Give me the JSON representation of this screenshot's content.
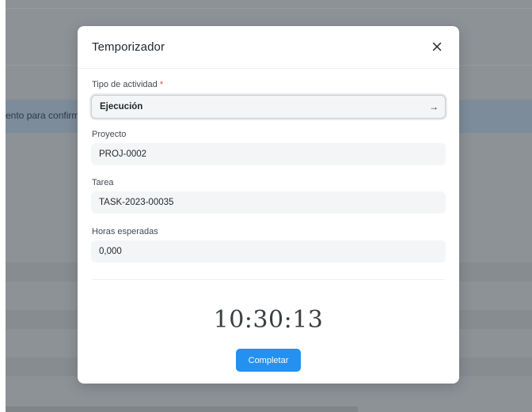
{
  "background": {
    "partial_text": "ento para confirm"
  },
  "modal": {
    "title": "Temporizador",
    "close_icon": "close-icon",
    "fields": {
      "activity_type": {
        "label": "Tipo de actividad",
        "required_mark": "*",
        "value": "Ejecución",
        "arrow": "→"
      },
      "project": {
        "label": "Proyecto",
        "value": "PROJ-0002"
      },
      "task": {
        "label": "Tarea",
        "value": "TASK-2023-00035"
      },
      "expected_hours": {
        "label": "Horas esperadas",
        "value": "0,000"
      }
    },
    "timer": "10:30:13",
    "complete_label": "Completar"
  },
  "colors": {
    "primary_button": "#2490ef",
    "required_star": "#e24c4c",
    "field_background": "#f4f5f6"
  }
}
